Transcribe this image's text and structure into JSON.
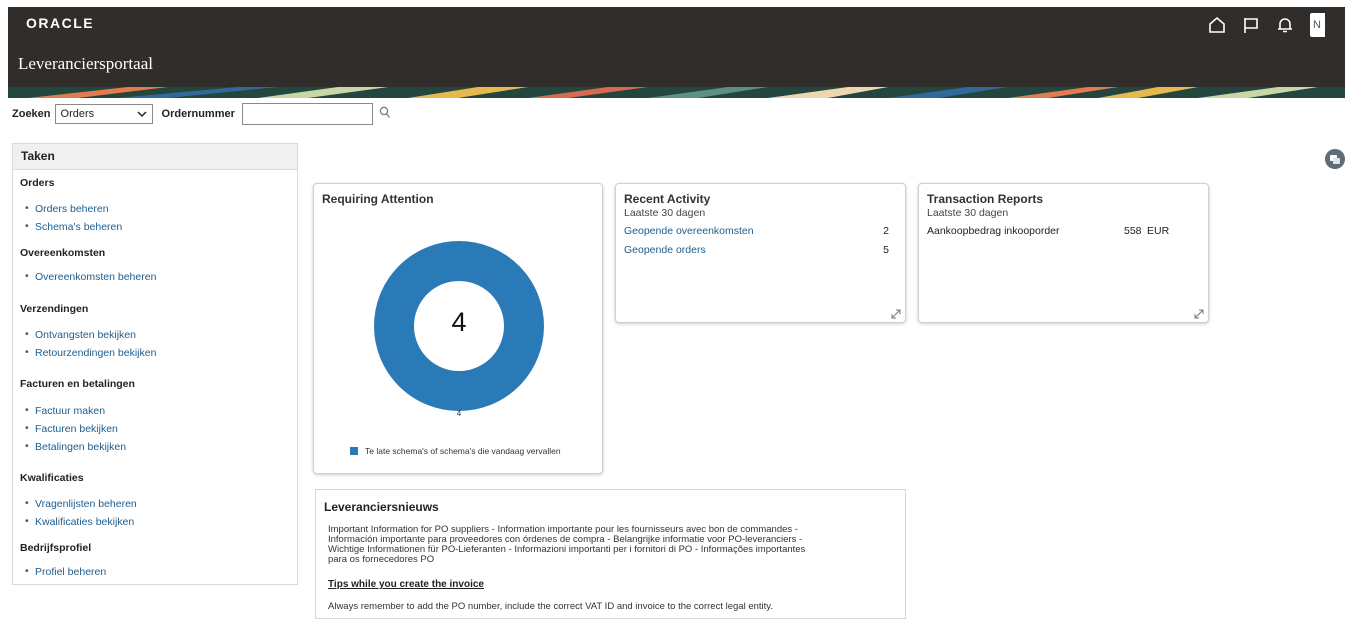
{
  "header": {
    "logo": "ORACLE",
    "app_title": "Leveranciersportaal",
    "user_initial": "N"
  },
  "search": {
    "label": "Zoeken",
    "select_value": "Orders",
    "field_label": "Ordernummer",
    "field_value": ""
  },
  "tasks": {
    "title": "Taken",
    "groups": [
      {
        "label": "Orders",
        "items": [
          "Orders beheren",
          "Schema's beheren"
        ]
      },
      {
        "label": "Overeenkomsten",
        "items": [
          "Overeenkomsten beheren"
        ]
      },
      {
        "label": "Verzendingen",
        "items": [
          "Ontvangsten bekijken",
          "Retourzendingen bekijken"
        ]
      },
      {
        "label": "Facturen en betalingen",
        "items": [
          "Factuur maken",
          "Facturen bekijken",
          "Betalingen bekijken"
        ]
      },
      {
        "label": "Kwalificaties",
        "items": [
          "Vragenlijsten beheren",
          "Kwalificaties bekijken"
        ]
      },
      {
        "label": "Bedrijfsprofiel",
        "items": [
          "Profiel beheren"
        ]
      }
    ]
  },
  "requiring_attention": {
    "title": "Requiring Attention",
    "center_value": "4",
    "slice_label": "4",
    "legend": "Te late schema's of schema's die vandaag vervallen",
    "color": "#2a7ab8"
  },
  "recent_activity": {
    "title": "Recent Activity",
    "subtitle": "Laatste 30 dagen",
    "rows": [
      {
        "label": "Geopende overeenkomsten",
        "value": "2"
      },
      {
        "label": "Geopende orders",
        "value": "5"
      }
    ]
  },
  "transaction_reports": {
    "title": "Transaction Reports",
    "subtitle": "Laatste 30 dagen",
    "rows": [
      {
        "label": "Aankoopbedrag inkooporder",
        "value": "558",
        "currency": "EUR"
      }
    ]
  },
  "news": {
    "title": "Leveranciersnieuws",
    "body": "Important Information for PO suppliers - Information importante pour les fournisseurs avec bon de commandes - Información importante para proveedores con órdenes de compra - Belangrijke informatie voor PO-leveranciers - Wichtige Informationen für PO-Lieferanten - Informazioni importanti per i fornitori di PO - Informações importantes para os fornecedores PO",
    "tip_title": "Tips while you create the invoice",
    "tip_text": "Always remember to add the PO number, include the correct VAT ID and invoice to the correct legal entity."
  }
}
